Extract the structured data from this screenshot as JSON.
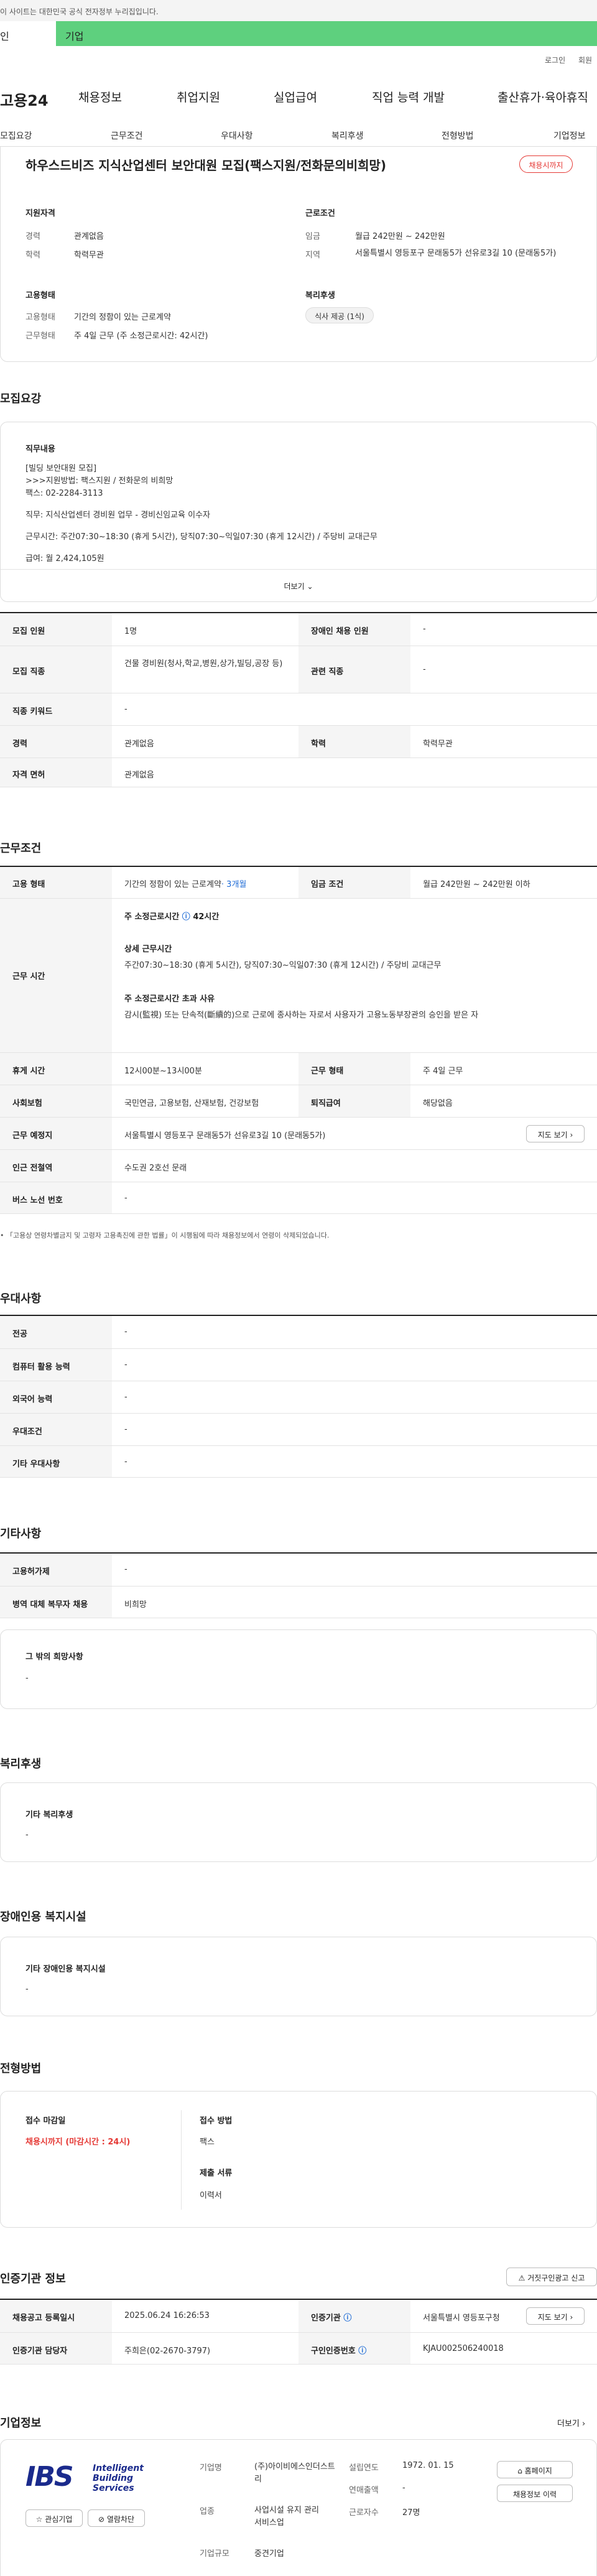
{
  "notice": "이 사이트는 대한민국 공식 전자정부 누리집입니다.",
  "tabs": {
    "personal": "인",
    "company": "기업"
  },
  "util": {
    "login": "로그인",
    "join": "회원"
  },
  "gnb": {
    "logo": "고용24",
    "items": [
      "채용정보",
      "취업지원",
      "실업급여",
      "직업 능력 개발",
      "출산휴가·육아휴직"
    ]
  },
  "subtabs": [
    "모집요강",
    "근무조건",
    "우대사항",
    "복리후생",
    "전형방법",
    "기업정보"
  ],
  "summary": {
    "title": "하우스드비즈 지식산업센터 보안대원 모집(팩스지원/전화문의비희망)",
    "badge": "채용시까지",
    "qual_title": "지원자격",
    "career_label": "경력",
    "career": "관계없음",
    "edu_label": "학력",
    "edu": "학력무관",
    "cond_title": "근로조건",
    "wage_label": "임금",
    "wage": "월급 242만원 ~ 242만원",
    "area_label": "지역",
    "area": "서울특별시 영등포구 문래동5가 선유로3길 10 (문래동5가)",
    "emp_title": "고용형태",
    "emp_label": "고용형태",
    "emp": "기간의 정함이 있는 근로계약",
    "work_label": "근무형태",
    "work": "주 4일 근무 (주 소정근로시간: 42시간)",
    "welfare_title": "복리후생",
    "welfare_tag": "식사 제공 (1식)"
  },
  "recruit": {
    "title": "모집요강",
    "content_label": "직무내용",
    "lines": [
      "[빌딩 보안대원 모집]",
      ">>>지원방법: 팩스지원 / 전화문의 비희망",
      "팩스: 02-2284-3113",
      "직무: 지식산업센터 경비원 업무 - 경비신임교육 이수자",
      "근무시간: 주간07:30~18:30 (휴게 5시간), 당직07:30~익일07:30 (휴게 12시간) / 주당비 교대근무",
      "급여: 월 2,424,105원"
    ],
    "more": "더보기",
    "rows": [
      [
        "모집 인원",
        "1명",
        "장애인 채용 인원",
        "-"
      ],
      [
        "모집 직종",
        "건물 경비원(청사,학교,병원,상가,빌딩,공장 등)",
        "관련 직종",
        "-"
      ],
      [
        "직종 키워드",
        "-"
      ],
      [
        "경력",
        "관계없음",
        "학력",
        "학력무관"
      ],
      [
        "자격 면허",
        "관계없음"
      ]
    ]
  },
  "workcond": {
    "title": "근무조건",
    "emp_label": "고용 형태",
    "emp": "기간의 정함이 있는 근로계약",
    "emp_period": "· 3개월",
    "wage_label": "임금 조건",
    "wage": "월급 242만원 ~ 242만원 이하",
    "time_label": "근무 시간",
    "time_weekly": "주 소정근로시간",
    "time_weekly_val": "42시간",
    "time_detail_title": "상세 근무시간",
    "time_detail": "주간07:30~18:30 (휴게 5시간), 당직07:30~익일07:30 (휴게 12시간) / 주당비 교대근무",
    "overtime_title": "주 소정근로시간 초과 사유",
    "overtime": "감시(監視) 또는 단속적(斷續的)으로 근로에 종사하는 자로서 사용자가 고용노동부장관의 승인을 받은 자",
    "rest_label": "휴게 시간",
    "rest": "12시00분~13시00분",
    "form_label": "근무 형태",
    "form": "주 4일 근무",
    "ins_label": "사회보험",
    "ins": "국민연금, 고용보험, 산재보험, 건강보험",
    "retire_label": "퇴직급여",
    "retire": "해당없음",
    "place_label": "근무 예정지",
    "place": "서울특별시 영등포구 문래동5가 선유로3길 10 (문래동5가)",
    "map": "지도 보기",
    "subway_label": "인근 전철역",
    "subway": "수도권 2호선 문래",
    "bus_label": "버스 노선 번호",
    "bus": "-",
    "footnote": "「고용상 연령차별금지 및 고령자 고용촉진에 관한 법률」이 시행됨에 따라 채용정보에서 연령이 삭제되었습니다."
  },
  "pref": {
    "title": "우대사항",
    "rows": [
      [
        "전공",
        "-"
      ],
      [
        "컴퓨터 활용 능력",
        "-"
      ],
      [
        "외국어 능력",
        "-"
      ],
      [
        "우대조건",
        "-"
      ],
      [
        "기타 우대사항",
        "-"
      ]
    ]
  },
  "etc": {
    "title": "기타사항",
    "rows": [
      [
        "고용허가제",
        "-"
      ],
      [
        "병역 대체 복무자 채용",
        "비희망"
      ]
    ],
    "hope_title": "그 밖의 희망사항",
    "hope": "-"
  },
  "welfare": {
    "title": "복리후생",
    "box_title": "기타 복리후생",
    "box": "-"
  },
  "disabled": {
    "title": "장애인용 복지시설",
    "box_title": "기타 장애인용 복지시설",
    "box": "-"
  },
  "selection": {
    "title": "전형방법",
    "deadline_title": "접수 마감일",
    "deadline": "채용시까지 (마감시간 : 24시)",
    "method_title": "접수 방법",
    "method": "팩스",
    "docs_title": "제출 서류",
    "docs": "이력서"
  },
  "agency": {
    "title": "인증기관 정보",
    "report": "거짓구인광고 신고",
    "reg_label": "채용공고 등록일시",
    "reg": "2025.06.24 16:26:53",
    "cert_label": "인증기관",
    "cert": "서울특별시 영등포구청",
    "map": "지도 보기",
    "mgr_label": "인증기관 담당자",
    "mgr": "주희은(02-2670-3797)",
    "no_label": "구인인증번호",
    "no": "KJAU002506240018"
  },
  "company": {
    "title": "기업정보",
    "more": "더보기",
    "logo_line1": "Intelligent",
    "logo_line2": "Building",
    "logo_line3": "Services",
    "logo_mark": "IBS",
    "fav": "관심기업",
    "block": "열람차단",
    "name_label": "기업명",
    "name": "(주)아이비에스인더스트리",
    "biz_label": "업종",
    "biz": "사업시설 유지 관리 서비스업",
    "size_label": "기업규모",
    "size": "중견기업",
    "est_label": "설립연도",
    "est": "1972. 01. 15",
    "sales_label": "연매출액",
    "sales": "-",
    "emp_label": "근로자수",
    "emp": "27명",
    "home": "홈페이지",
    "list": "채용정보 이력"
  },
  "colors": {
    "green": "#5ed07e",
    "red": "#e53935",
    "blue": "#1e6bd6"
  }
}
